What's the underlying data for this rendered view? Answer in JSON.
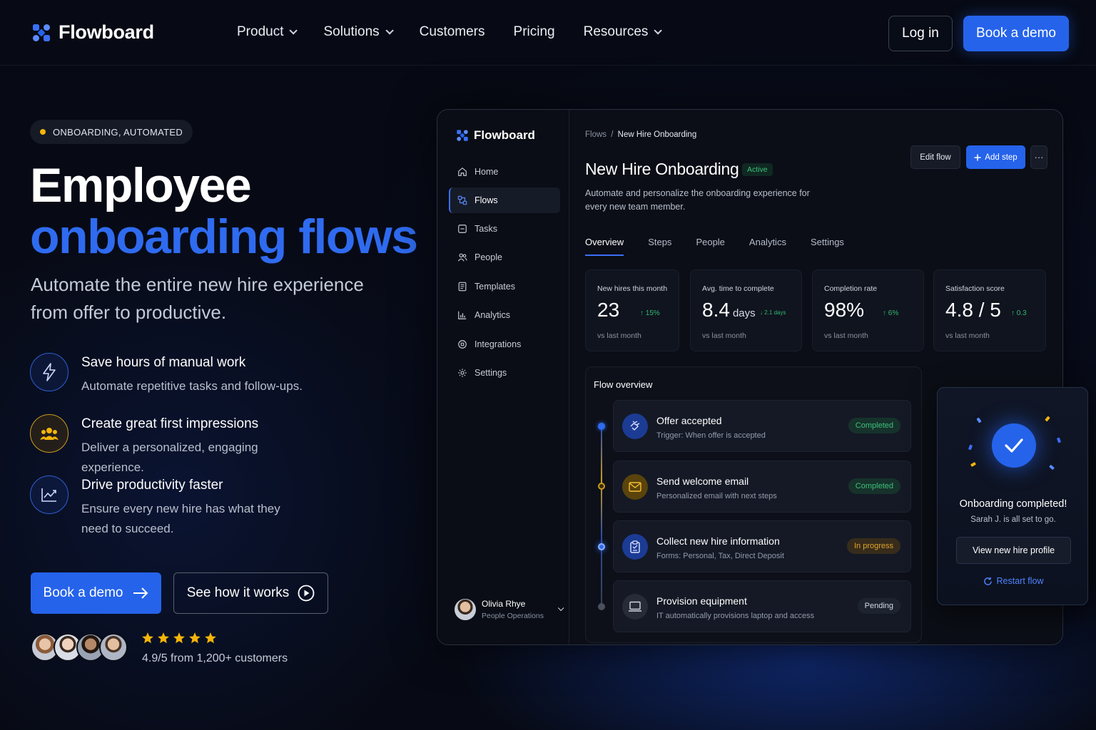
{
  "nav": {
    "brand": "Flowboard",
    "links": [
      {
        "label": "Product",
        "dropdown": true
      },
      {
        "label": "Solutions",
        "dropdown": true
      },
      {
        "label": "Customers",
        "dropdown": false
      },
      {
        "label": "Pricing",
        "dropdown": false
      },
      {
        "label": "Resources",
        "dropdown": true
      }
    ],
    "login_label": "Log in",
    "demo_label": "Book a demo"
  },
  "hero": {
    "badge": "ONBOARDING, AUTOMATED",
    "title_line1": "Employee",
    "title_line2": "onboarding flows",
    "subtitle": "Automate the entire new hire experience from offer to productive.",
    "features": [
      {
        "icon": "lightning-icon",
        "title": "Save hours of manual work",
        "desc": "Automate repetitive tasks and follow-ups."
      },
      {
        "icon": "people-icon",
        "title": "Create great first impressions",
        "desc": "Deliver a personalized, engaging experience."
      },
      {
        "icon": "chart-icon",
        "title": "Drive productivity faster",
        "desc": "Ensure every new hire has what they need to succeed."
      }
    ],
    "cta_primary": "Book a demo",
    "cta_secondary": "See how it works",
    "rating_text": "4.9/5 from 1,200+ customers",
    "stars": 5
  },
  "app": {
    "brand": "Flowboard",
    "sidebar": [
      {
        "label": "Home",
        "icon": "home-icon",
        "active": false
      },
      {
        "label": "Flows",
        "icon": "flows-icon",
        "active": true
      },
      {
        "label": "Tasks",
        "icon": "tasks-icon",
        "active": false
      },
      {
        "label": "People",
        "icon": "people-icon",
        "active": false
      },
      {
        "label": "Templates",
        "icon": "templates-icon",
        "active": false
      },
      {
        "label": "Analytics",
        "icon": "analytics-icon",
        "active": false
      },
      {
        "label": "Integrations",
        "icon": "integrations-icon",
        "active": false
      },
      {
        "label": "Settings",
        "icon": "settings-icon",
        "active": false
      }
    ],
    "user": {
      "name": "Olivia Rhye",
      "role": "People Operations"
    },
    "breadcrumb": {
      "parent": "Flows",
      "separator": "/",
      "current": "New Hire Onboarding"
    },
    "actions": {
      "edit": "Edit flow",
      "add": "Add step",
      "more": "···"
    },
    "title": "New Hire Onboarding",
    "status": "Active",
    "description": "Automate and personalize the onboarding experience for every new team member.",
    "tabs": [
      "Overview",
      "Steps",
      "People",
      "Analytics",
      "Settings"
    ],
    "active_tab": "Overview",
    "stats": [
      {
        "label": "New hires this month",
        "value": "23",
        "unit": "",
        "delta": "↑ 15%",
        "foot": "vs last month"
      },
      {
        "label": "Avg. time to complete",
        "value": "8.4",
        "unit": "days",
        "delta": "↓ 2.1 days",
        "foot": "vs last month"
      },
      {
        "label": "Completion rate",
        "value": "98%",
        "unit": "",
        "delta": "↑ 6%",
        "foot": "vs last month"
      },
      {
        "label": "Satisfaction score",
        "value": "4.8 / 5",
        "unit": "",
        "delta": "↑ 0.3",
        "foot": "vs last month"
      }
    ],
    "flow_overview": {
      "title": "Flow overview",
      "steps": [
        {
          "title": "Offer accepted",
          "sub": "Trigger: When offer is accepted",
          "status": "Completed",
          "icon": "handshake-icon"
        },
        {
          "title": "Send welcome email",
          "sub": "Personalized email with next steps",
          "status": "Completed",
          "icon": "mail-icon"
        },
        {
          "title": "Collect new hire information",
          "sub": "Forms: Personal, Tax, Direct Deposit",
          "status": "In progress",
          "icon": "clipboard-icon"
        },
        {
          "title": "Provision equipment",
          "sub": "IT automatically provisions laptop and access",
          "status": "Pending",
          "icon": "laptop-icon"
        }
      ]
    },
    "toast": {
      "title": "Onboarding completed!",
      "sub": "Sarah J. is all set to go.",
      "button": "View new hire profile",
      "restart": "Restart flow"
    }
  },
  "colors": {
    "accent": "#2563eb",
    "accent_text": "#2f6bf0",
    "gold": "#f5b50a",
    "success": "#3cc07a",
    "warning": "#e0a32a",
    "background": "#070a14"
  }
}
